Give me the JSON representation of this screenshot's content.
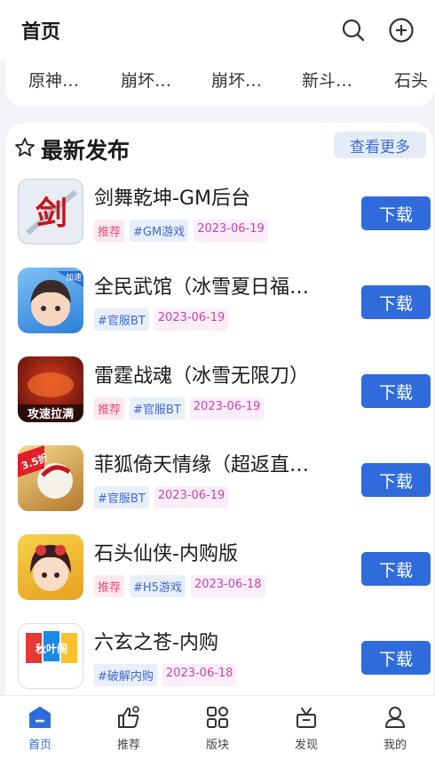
{
  "header": {
    "title": "首页",
    "icons": [
      "search-icon",
      "add-circle-icon"
    ]
  },
  "categories": [
    "原神…",
    "崩坏…",
    "崩坏…",
    "新斗…",
    "石头"
  ],
  "section": {
    "title": "最新发布",
    "more_label": "查看更多",
    "icon": "star-outline-icon"
  },
  "download_label": "下载",
  "games": [
    {
      "name": "剑舞乾坤-GM后台",
      "tags": [
        {
          "text": "推荐",
          "style": "red"
        },
        {
          "text": "#GM游戏",
          "style": "blue"
        }
      ],
      "date": "2023-06-19"
    },
    {
      "name": "全民武馆（冰雪夏日福…",
      "tags": [
        {
          "text": "#官服BT",
          "style": "blue"
        }
      ],
      "date": "2023-06-19"
    },
    {
      "name": "雷霆战魂（冰雪无限刀）",
      "tags": [
        {
          "text": "推荐",
          "style": "red"
        },
        {
          "text": "#官服BT",
          "style": "blue"
        }
      ],
      "date": "2023-06-19"
    },
    {
      "name": "菲狐倚天情缘（超返直…",
      "tags": [
        {
          "text": "#官服BT",
          "style": "blue"
        }
      ],
      "date": "2023-06-19"
    },
    {
      "name": "石头仙侠-内购版",
      "tags": [
        {
          "text": "推荐",
          "style": "red"
        },
        {
          "text": "#H5游戏",
          "style": "blue"
        }
      ],
      "date": "2023-06-18"
    },
    {
      "name": "六玄之苍-内购",
      "tags": [
        {
          "text": "#破解内购",
          "style": "blue"
        }
      ],
      "date": "2023-06-18"
    }
  ],
  "icon_overlays": [
    "剑",
    "加速",
    "攻速拉满",
    "3.5折",
    "",
    "秋叶阁"
  ],
  "bottom_nav": [
    {
      "label": "首页",
      "icon": "home-icon",
      "active": true
    },
    {
      "label": "推荐",
      "icon": "thumbs-up-icon",
      "active": false
    },
    {
      "label": "版块",
      "icon": "grid-icon",
      "active": false
    },
    {
      "label": "发现",
      "icon": "gift-icon",
      "active": false
    },
    {
      "label": "我的",
      "icon": "user-icon",
      "active": false
    }
  ],
  "colors": {
    "accent": "#2f6bdb",
    "background": "#f2f3f6"
  }
}
